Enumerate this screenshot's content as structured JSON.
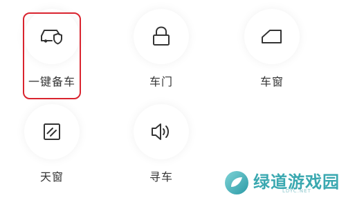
{
  "controls": [
    {
      "label": "一键备车",
      "icon": "car-shield-icon"
    },
    {
      "label": "车门",
      "icon": "lock-icon"
    },
    {
      "label": "车窗",
      "icon": "window-icon"
    },
    {
      "label": "天窗",
      "icon": "sunroof-icon"
    },
    {
      "label": "寻车",
      "icon": "speaker-icon"
    }
  ],
  "watermark": {
    "text": "绿道游戏园",
    "sub": "LDYC.NET",
    "color": "#3aa8b0"
  },
  "highlight_color": "#d9232e"
}
